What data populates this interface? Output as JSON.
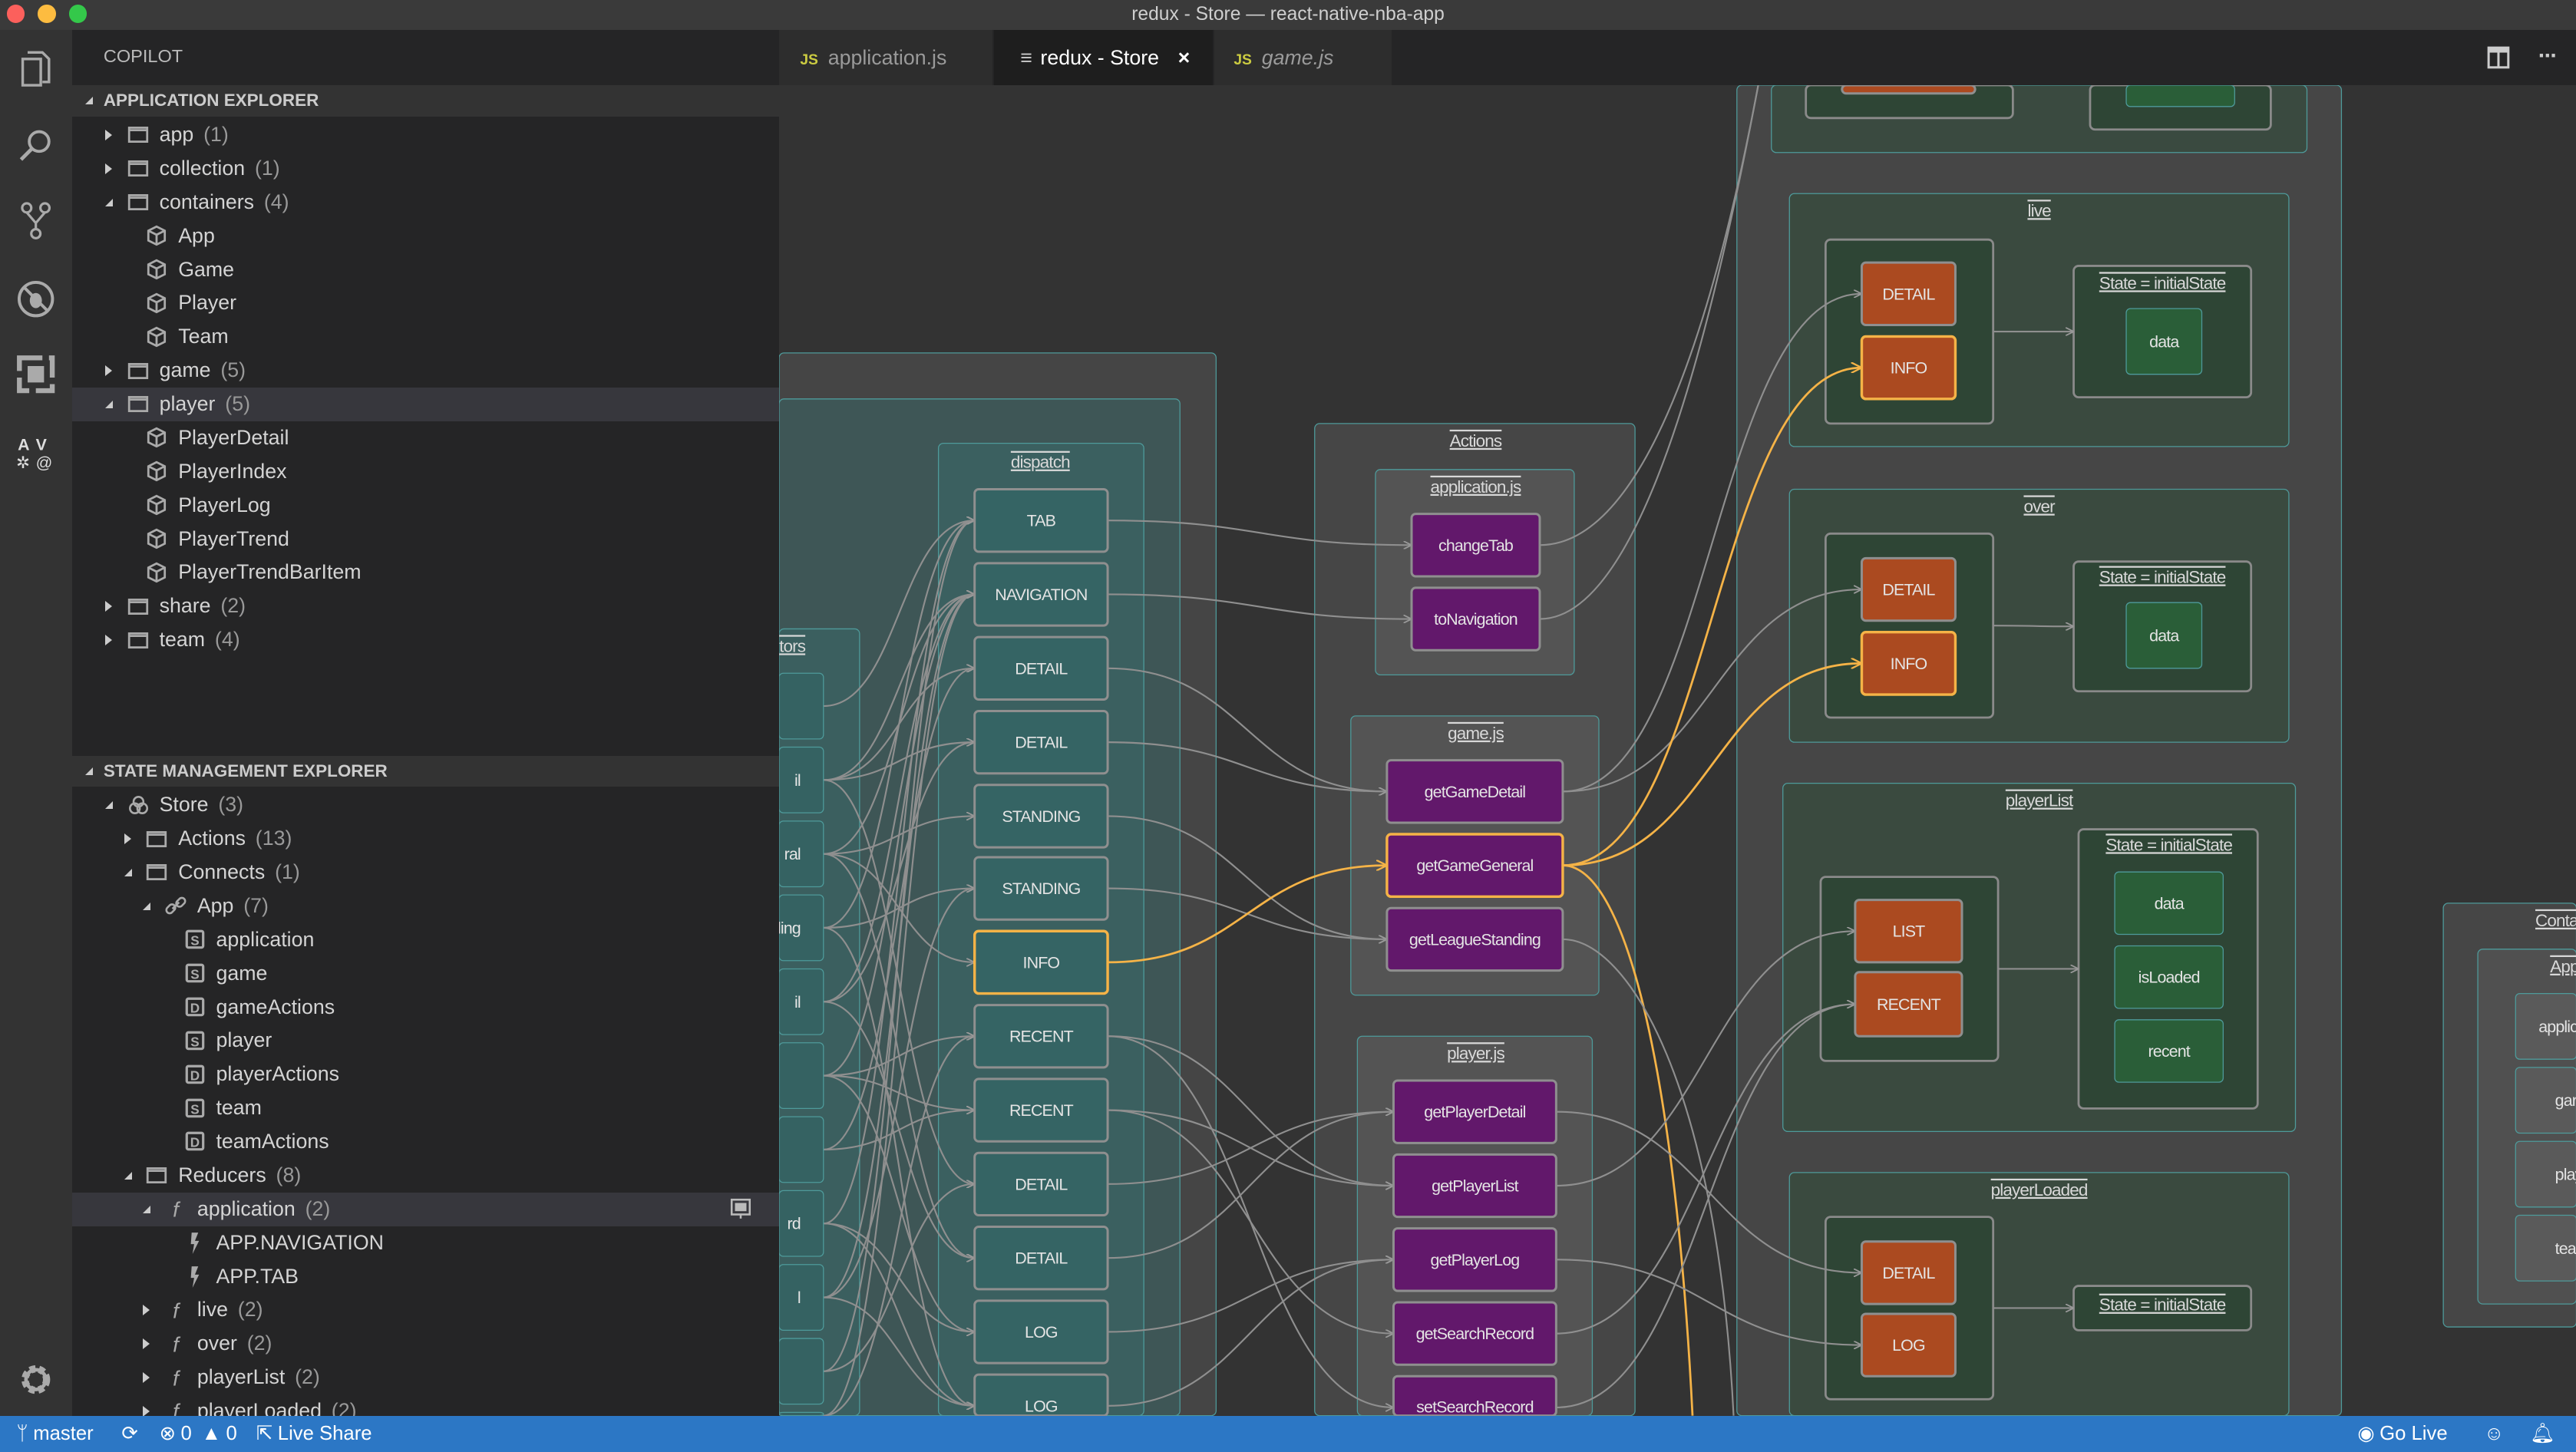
{
  "window": {
    "title": "redux - Store — react-native-nba-app"
  },
  "activity_bar": {
    "icons": [
      "files-icon",
      "search-icon",
      "source-control-icon",
      "debug-icon",
      "extensions-icon",
      "frameworks-icon",
      "gear-icon"
    ]
  },
  "sidebar": {
    "title": "COPILOT",
    "application_explorer": {
      "header": "APPLICATION EXPLORER",
      "items": [
        {
          "label": "app",
          "count": "(1)",
          "icon": "folder",
          "level": 0,
          "arrow": "collapsed"
        },
        {
          "label": "collection",
          "count": "(1)",
          "icon": "folder",
          "level": 0,
          "arrow": "collapsed"
        },
        {
          "label": "containers",
          "count": "(4)",
          "icon": "folder",
          "level": 0,
          "arrow": "expanded"
        },
        {
          "label": "App",
          "icon": "cube",
          "level": 1
        },
        {
          "label": "Game",
          "icon": "cube",
          "level": 1
        },
        {
          "label": "Player",
          "icon": "cube",
          "level": 1
        },
        {
          "label": "Team",
          "icon": "cube",
          "level": 1
        },
        {
          "label": "game",
          "count": "(5)",
          "icon": "folder",
          "level": 0,
          "arrow": "collapsed"
        },
        {
          "label": "player",
          "count": "(5)",
          "icon": "folder",
          "level": 0,
          "arrow": "expanded",
          "selected": true
        },
        {
          "label": "PlayerDetail",
          "icon": "cube",
          "level": 1
        },
        {
          "label": "PlayerIndex",
          "icon": "cube",
          "level": 1
        },
        {
          "label": "PlayerLog",
          "icon": "cube",
          "level": 1
        },
        {
          "label": "PlayerTrend",
          "icon": "cube",
          "level": 1
        },
        {
          "label": "PlayerTrendBarItem",
          "icon": "cube",
          "level": 1
        },
        {
          "label": "share",
          "count": "(2)",
          "icon": "folder",
          "level": 0,
          "arrow": "collapsed"
        },
        {
          "label": "team",
          "count": "(4)",
          "icon": "folder",
          "level": 0,
          "arrow": "collapsed"
        }
      ]
    },
    "state_explorer": {
      "header": "STATE MANAGEMENT EXPLORER",
      "items": [
        {
          "label": "Store",
          "count": "(3)",
          "icon": "store",
          "level": 0,
          "arrow": "expanded"
        },
        {
          "label": "Actions",
          "count": "(13)",
          "icon": "folder",
          "level": 1,
          "arrow": "collapsed"
        },
        {
          "label": "Connects",
          "count": "(1)",
          "icon": "folder",
          "level": 1,
          "arrow": "expanded"
        },
        {
          "label": "App",
          "count": "(7)",
          "icon": "link",
          "level": 2,
          "arrow": "expanded"
        },
        {
          "label": "application",
          "icon": "state",
          "level": 3
        },
        {
          "label": "game",
          "icon": "state",
          "level": 3
        },
        {
          "label": "gameActions",
          "icon": "dispatch",
          "level": 3
        },
        {
          "label": "player",
          "icon": "state",
          "level": 3
        },
        {
          "label": "playerActions",
          "icon": "dispatch",
          "level": 3
        },
        {
          "label": "team",
          "icon": "state",
          "level": 3
        },
        {
          "label": "teamActions",
          "icon": "dispatch",
          "level": 3
        },
        {
          "label": "Reducers",
          "count": "(8)",
          "icon": "folder",
          "level": 1,
          "arrow": "expanded"
        },
        {
          "label": "application",
          "count": "(2)",
          "icon": "function",
          "level": 2,
          "arrow": "expanded",
          "selected": true,
          "action_icon": "preview-icon"
        },
        {
          "label": "APP.NAVIGATION",
          "icon": "bolt",
          "level": 3
        },
        {
          "label": "APP.TAB",
          "icon": "bolt",
          "level": 3
        },
        {
          "label": "live",
          "count": "(2)",
          "icon": "function",
          "level": 2,
          "arrow": "collapsed"
        },
        {
          "label": "over",
          "count": "(2)",
          "icon": "function",
          "level": 2,
          "arrow": "collapsed"
        },
        {
          "label": "playerList",
          "count": "(2)",
          "icon": "function",
          "level": 2,
          "arrow": "collapsed"
        },
        {
          "label": "playerLoaded",
          "count": "(2)",
          "icon": "function",
          "level": 2,
          "arrow": "collapsed"
        }
      ]
    }
  },
  "tabs": [
    {
      "label": "application.js",
      "icon": "JS",
      "active": false,
      "italic": false
    },
    {
      "label": "redux - Store",
      "icon": "≡",
      "active": true,
      "close": "×"
    },
    {
      "label": "game.js",
      "icon": "JS",
      "active": false,
      "italic": true
    }
  ],
  "editor_actions": [
    "split-editor-icon",
    "more-icon"
  ],
  "diagram": {
    "colors": {
      "action": "#62186b",
      "dispatch": "#356464",
      "reducer_type": "#ab4a20",
      "state": "#2a5e38",
      "highlight": "#f5b347",
      "edge": "#8f8f8f"
    },
    "groups": {
      "g_creators": "tors",
      "g_dispatch": "dispatch",
      "g_actions": "Actions",
      "g_appjs": "application.js",
      "g_gamejs": "game.js",
      "g_playerjs": "player.js",
      "g_live": "live",
      "g_live_s": "State = initialState",
      "g_over": "over",
      "g_over_s": "State = initialState",
      "g_list": "playerList",
      "g_list_s": "State = initialState",
      "g_pld": "playerLoaded",
      "g_pld_s": "State = initialState",
      "g_cont": "Conta",
      "g_app": "App"
    },
    "nodes": {
      "c0": "",
      "c1": "il",
      "c2": "ral",
      "c3": "ling",
      "c4": "il",
      "c5": "",
      "c6": "",
      "c7": "rd",
      "c8": "l",
      "c9": "",
      "c10": "",
      "d0": "TAB",
      "d1": "NAVIGATION",
      "d2": "DETAIL",
      "d3": "DETAIL",
      "d4": "STANDING",
      "d5": "STANDING",
      "d6": "INFO",
      "d7": "RECENT",
      "d8": "RECENT",
      "d9": "DETAIL",
      "d10": "DETAIL",
      "d11": "LOG",
      "d12": "LOG",
      "a_ct": "changeTab",
      "a_tn": "toNavigation",
      "a_ggd": "getGameDetail",
      "a_ggg": "getGameGeneral",
      "a_gls": "getLeagueStanding",
      "a_gpd": "getPlayerDetail",
      "a_gpl": "getPlayerList",
      "a_gplog": "getPlayerLog",
      "a_gsr": "getSearchRecord",
      "a_ssr": "setSearchRecord",
      "top_o": "",
      "top_g": "",
      "live_detail": "DETAIL",
      "live_info": "INFO",
      "live_data": "data",
      "over_detail": "DETAIL",
      "over_info": "INFO",
      "over_data": "data",
      "list_list": "LIST",
      "list_recent": "RECENT",
      "list_data": "data",
      "list_loaded": "isLoaded",
      "list_recent_s": "recent",
      "pld_detail": "DETAIL",
      "pld_log": "LOG",
      "app_1": "applic",
      "app_2": "gar",
      "app_3": "play",
      "app_4": "tea"
    },
    "highlighted": [
      "d6",
      "a_ggg",
      "live_info",
      "over_info"
    ],
    "edges": [
      [
        "d0",
        "a_ct"
      ],
      [
        "d1",
        "a_tn"
      ],
      [
        "d2",
        "a_ggd"
      ],
      [
        "d3",
        "a_ggd"
      ],
      [
        "d4",
        "a_gls"
      ],
      [
        "d5",
        "a_gls"
      ],
      [
        "d6",
        "a_ggg",
        "highlight"
      ],
      [
        "d7",
        "a_ssr"
      ],
      [
        "d8",
        "a_gsr"
      ],
      [
        "d9",
        "a_gpd"
      ],
      [
        "d10",
        "a_gpd"
      ],
      [
        "d11",
        "a_gplog"
      ],
      [
        "d12",
        "a_gplog"
      ],
      [
        "d7",
        "a_gpl"
      ],
      [
        "d8",
        "a_gpl"
      ],
      [
        "a_ct",
        "top_o"
      ],
      [
        "a_tn",
        "top_o"
      ],
      [
        "a_ggd",
        "live_detail"
      ],
      [
        "a_ggd",
        "over_detail"
      ],
      [
        "a_ggg",
        "live_info",
        "highlight"
      ],
      [
        "a_ggg",
        "over_info",
        "highlight"
      ],
      [
        "a_ggg",
        "off_bottom",
        "highlight"
      ],
      [
        "a_gls",
        "off_bottom2"
      ],
      [
        "a_gpd",
        "pld_detail"
      ],
      [
        "a_gpl",
        "list_list"
      ],
      [
        "a_gplog",
        "pld_log"
      ],
      [
        "a_gsr",
        "list_recent"
      ],
      [
        "a_ssr",
        "list_recent"
      ],
      [
        "g_live_l",
        "g_live_s"
      ],
      [
        "g_over_l",
        "g_over_s"
      ],
      [
        "g_list_l",
        "g_list_s"
      ],
      [
        "g_pld_l",
        "g_pld_s"
      ],
      [
        "c0",
        "d0"
      ],
      [
        "c1",
        "d2"
      ],
      [
        "c1",
        "d3"
      ],
      [
        "c1",
        "d9"
      ],
      [
        "c1",
        "d1"
      ],
      [
        "c2",
        "d6"
      ],
      [
        "c2",
        "d4"
      ],
      [
        "c2",
        "d1"
      ],
      [
        "c2",
        "d10"
      ],
      [
        "c3",
        "d5"
      ],
      [
        "c3",
        "d0"
      ],
      [
        "c3",
        "d12"
      ],
      [
        "c4",
        "d10"
      ],
      [
        "c4",
        "d3"
      ],
      [
        "c4",
        "d1"
      ],
      [
        "c5",
        "d7"
      ],
      [
        "c5",
        "d1"
      ],
      [
        "c5",
        "d11"
      ],
      [
        "c5",
        "d8"
      ],
      [
        "c6",
        "d8"
      ],
      [
        "c6",
        "d2"
      ],
      [
        "c7",
        "d11"
      ],
      [
        "c7",
        "d0"
      ],
      [
        "c7",
        "d12"
      ],
      [
        "c8",
        "d12"
      ],
      [
        "c8",
        "d1"
      ],
      [
        "c8",
        "d5"
      ],
      [
        "c9",
        "d9"
      ],
      [
        "c9",
        "d0"
      ],
      [
        "c10",
        "d7"
      ],
      [
        "c10",
        "d1"
      ]
    ]
  },
  "status_bar": {
    "branch": "master",
    "errors": "0",
    "warnings": "0",
    "live_share": "Live Share",
    "go_live": "Go Live"
  }
}
